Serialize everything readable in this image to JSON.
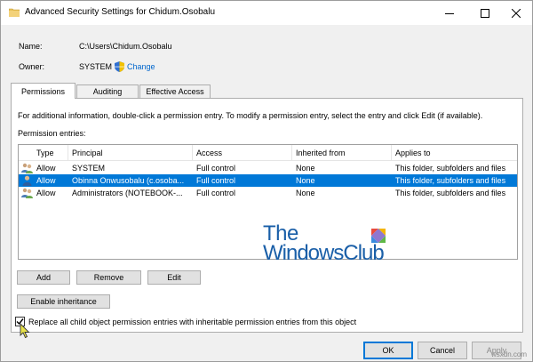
{
  "window": {
    "title": "Advanced Security Settings for Chidum.Osobalu"
  },
  "fields": {
    "name_label": "Name:",
    "name_value": "C:\\Users\\Chidum.Osobalu",
    "owner_label": "Owner:",
    "owner_value": "SYSTEM",
    "change_link": "Change"
  },
  "tabs": [
    {
      "label": "Permissions",
      "active": true
    },
    {
      "label": "Auditing",
      "active": false
    },
    {
      "label": "Effective Access",
      "active": false
    }
  ],
  "panel": {
    "info_text": "For additional information, double-click a permission entry. To modify a permission entry, select the entry and click Edit (if available).",
    "entries_label": "Permission entries:"
  },
  "table": {
    "columns": [
      "Type",
      "Principal",
      "Access",
      "Inherited from",
      "Applies to"
    ],
    "rows": [
      {
        "type": "Allow",
        "principal": "SYSTEM",
        "access": "Full control",
        "inherited": "None",
        "applies": "This folder, subfolders and files",
        "selected": false,
        "icon": "user-group-icon"
      },
      {
        "type": "Allow",
        "principal": "Obinna Onwusobalu (c.osoba...",
        "access": "Full control",
        "inherited": "None",
        "applies": "This folder, subfolders and files",
        "selected": true,
        "icon": "user-icon"
      },
      {
        "type": "Allow",
        "principal": "Administrators (NOTEBOOK-...",
        "access": "Full control",
        "inherited": "None",
        "applies": "This folder, subfolders and files",
        "selected": false,
        "icon": "user-group-icon"
      }
    ]
  },
  "watermark": {
    "line1": "The",
    "line2": "WindowsClub"
  },
  "buttons": {
    "add": "Add",
    "remove": "Remove",
    "edit": "Edit",
    "enable_inheritance": "Enable inheritance"
  },
  "checkbox": {
    "label": "Replace all child object permission entries with inheritable permission entries from this object",
    "checked": true
  },
  "dialog_buttons": {
    "ok": "OK",
    "cancel": "Cancel",
    "apply": "Apply"
  },
  "site_mark": "wsxdn.com",
  "colors": {
    "selection": "#0078d7",
    "link": "#0066cc",
    "watermark": "#1a5fa8"
  }
}
